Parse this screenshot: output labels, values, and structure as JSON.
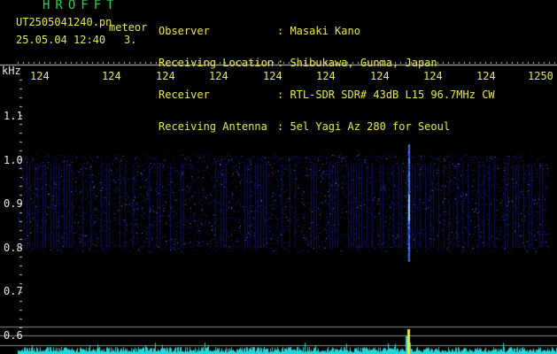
{
  "app_title": "HROFFT",
  "filename": "UT2505041240.pn",
  "meteor_label": "meteor",
  "datetime": "25.05.04 12:40",
  "count": "3.",
  "info": {
    "labels": [
      "Observer",
      "Receiving Location",
      "Receiver",
      "Receiving Antenna"
    ],
    "values": [
      ": Masaki Kano",
      ": Shibukawa, Gunma, Japan",
      ": RTL-SDR SDR# 43dB L15 96.7MHz CW",
      ": 5el Yagi Az 280 for Seoul"
    ]
  },
  "unit_label": "kHz",
  "x_ticks": [
    "124",
    "124",
    "124",
    "124",
    "124",
    "124",
    "124",
    "124",
    "124",
    "1250"
  ],
  "y_ticks": [
    "1.1",
    "1.0",
    "0.9",
    "0.8",
    "0.7",
    "0.6"
  ],
  "colors": {
    "background": "#000000",
    "title_green": "#21d24a",
    "label_yellow": "#e8e84a",
    "noise_blue": "#3344ff",
    "echo_blue": "#4a8cff",
    "spectrum_cyan": "#22d8d8"
  },
  "signal": {
    "echo_frequency_khz_range": [
      0.775,
      1.03
    ]
  }
}
